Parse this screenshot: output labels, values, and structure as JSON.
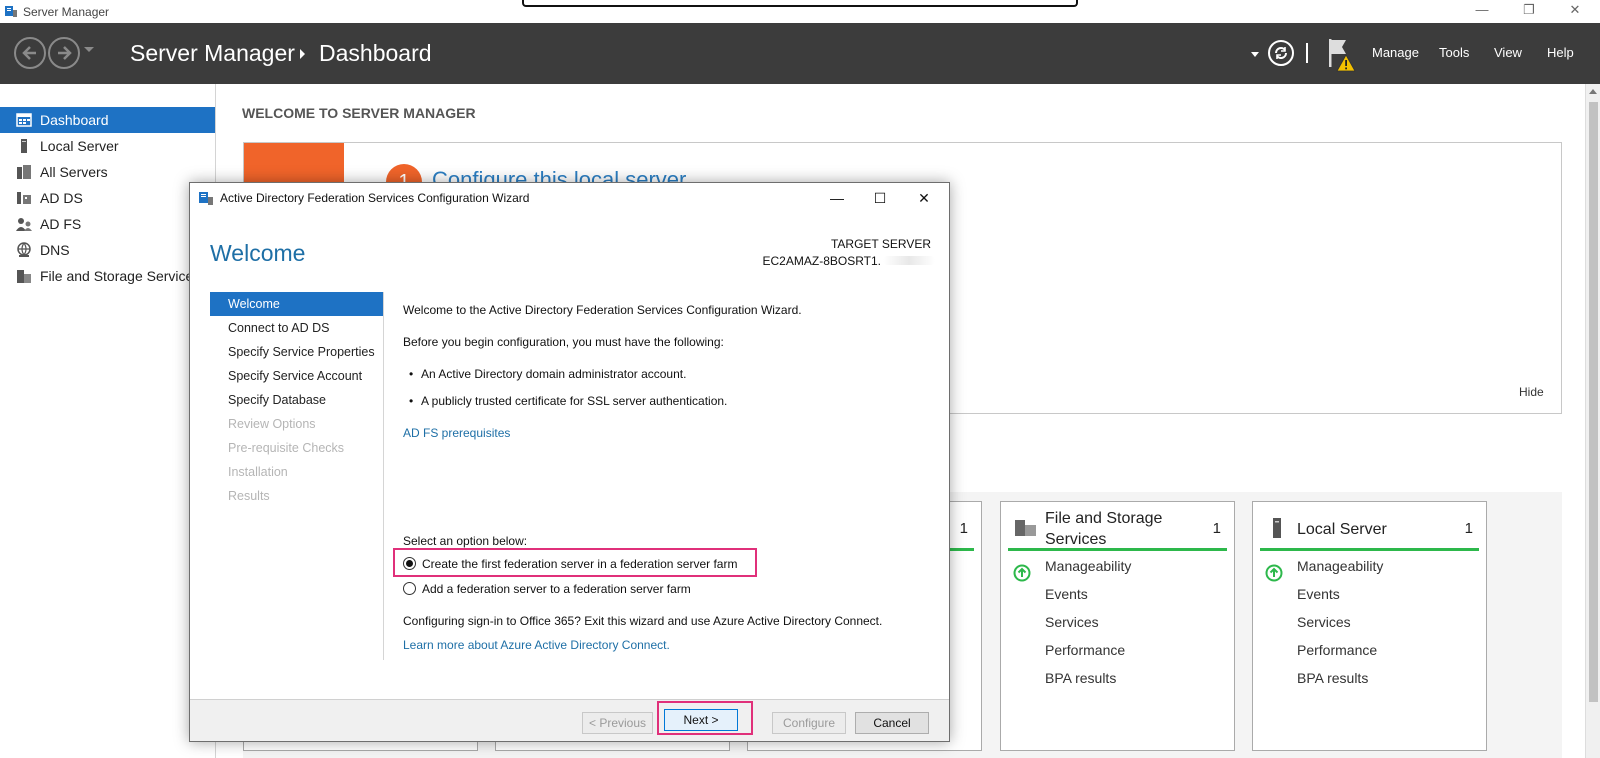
{
  "window": {
    "title": "Server Manager",
    "controls": {
      "minimize": "—",
      "restore": "❐",
      "close": "✕"
    }
  },
  "header": {
    "app_name": "Server Manager",
    "page": "Dashboard",
    "menu": [
      "Manage",
      "Tools",
      "View",
      "Help"
    ]
  },
  "sidebar": {
    "items": [
      {
        "label": "Dashboard",
        "icon": "dashboard-icon",
        "active": true
      },
      {
        "label": "Local Server",
        "icon": "server-icon"
      },
      {
        "label": "All Servers",
        "icon": "servers-icon"
      },
      {
        "label": "AD DS",
        "icon": "ad-ds-icon"
      },
      {
        "label": "AD FS",
        "icon": "ad-fs-icon"
      },
      {
        "label": "DNS",
        "icon": "dns-icon"
      },
      {
        "label": "File and Storage Services",
        "icon": "file-storage-icon"
      }
    ]
  },
  "main": {
    "welcome_title": "WELCOME TO SERVER MANAGER",
    "step_number": "1",
    "step_link": "Configure this local server",
    "hide": "Hide",
    "tiles": [
      {
        "title": "File and Storage Services",
        "count": "1",
        "rows": [
          "Manageability",
          "Events",
          "Services",
          "Performance",
          "BPA results"
        ]
      },
      {
        "title": "Local Server",
        "count": "1",
        "rows": [
          "Manageability",
          "Events",
          "Services",
          "Performance",
          "BPA results"
        ]
      }
    ],
    "partial_tile_count": "1"
  },
  "wizard": {
    "title": "Active Directory Federation Services Configuration Wizard",
    "controls": {
      "minimize": "—",
      "maximize": "☐",
      "close": "✕"
    },
    "heading": "Welcome",
    "target_label": "TARGET SERVER",
    "target_value": "EC2AMAZ-8BOSRT1.",
    "steps": [
      {
        "label": "Welcome",
        "state": "active"
      },
      {
        "label": "Connect to AD DS",
        "state": "enabled"
      },
      {
        "label": "Specify Service Properties",
        "state": "enabled"
      },
      {
        "label": "Specify Service Account",
        "state": "enabled"
      },
      {
        "label": "Specify Database",
        "state": "enabled"
      },
      {
        "label": "Review Options",
        "state": "disabled"
      },
      {
        "label": "Pre-requisite Checks",
        "state": "disabled"
      },
      {
        "label": "Installation",
        "state": "disabled"
      },
      {
        "label": "Results",
        "state": "disabled"
      }
    ],
    "content": {
      "intro": "Welcome to the Active Directory Federation Services Configuration Wizard.",
      "before": "Before you begin configuration, you must have the following:",
      "bullets": [
        "An Active Directory domain administrator account.",
        "A publicly trusted certificate for SSL server authentication."
      ],
      "prereq_link": "AD FS prerequisites",
      "select_label": "Select an option below:",
      "options": [
        {
          "label": "Create the first federation server in a federation server farm",
          "checked": true
        },
        {
          "label": "Add a federation server to a federation server farm",
          "checked": false
        }
      ],
      "office_note": "Configuring sign-in to Office 365? Exit this wizard and use Azure Active Directory Connect.",
      "azure_link": "Learn more about Azure Active Directory Connect."
    },
    "buttons": {
      "previous": "< Previous",
      "next": "Next >",
      "configure": "Configure",
      "cancel": "Cancel"
    }
  },
  "colors": {
    "header_bg": "#3c3c3c",
    "accent_blue": "#1e72c4",
    "orange": "#f0642a",
    "status_green": "#2db84b",
    "highlight_pink": "#e0307a"
  }
}
